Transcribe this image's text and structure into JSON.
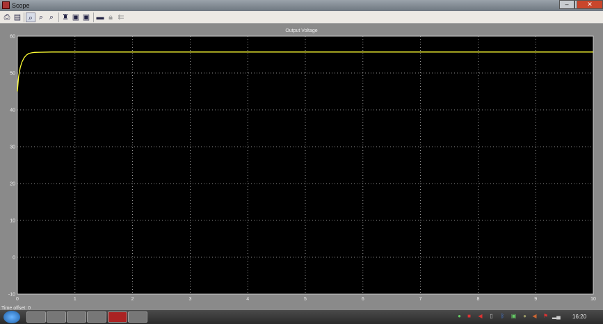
{
  "window": {
    "title": "Scope"
  },
  "toolbar": {
    "icons": [
      "print-icon",
      "parameters-icon",
      "zoom-icon",
      "zoom-x-icon",
      "zoom-y-icon",
      "autoscale-icon",
      "save-axes-icon",
      "restore-axes-icon",
      "floating-scope-icon",
      "lock-icon",
      "signal-select-icon"
    ]
  },
  "plot": {
    "title": "Output Voltage",
    "background": "#000000",
    "line_color": "#ffff33"
  },
  "status": {
    "time_offset": "Time offset:  0"
  },
  "taskbar": {
    "clock": "16:20"
  },
  "chart_data": {
    "type": "line",
    "title": "Output Voltage",
    "xlabel": "",
    "ylabel": "",
    "xlim": [
      0,
      10
    ],
    "ylim": [
      -10,
      60
    ],
    "xticks": [
      0,
      1,
      2,
      3,
      4,
      5,
      6,
      7,
      8,
      9,
      10
    ],
    "yticks": [
      -10,
      0,
      10,
      20,
      30,
      40,
      50,
      60
    ],
    "grid": true,
    "series": [
      {
        "name": "Output Voltage",
        "x": [
          0,
          0.02,
          0.05,
          0.08,
          0.12,
          0.16,
          0.2,
          0.25,
          0.3,
          0.4,
          0.6,
          1,
          2,
          5,
          10
        ],
        "y": [
          45,
          49,
          51.5,
          53,
          54.2,
          54.9,
          55.3,
          55.5,
          55.6,
          55.65,
          55.7,
          55.7,
          55.7,
          55.7,
          55.7
        ]
      }
    ]
  }
}
